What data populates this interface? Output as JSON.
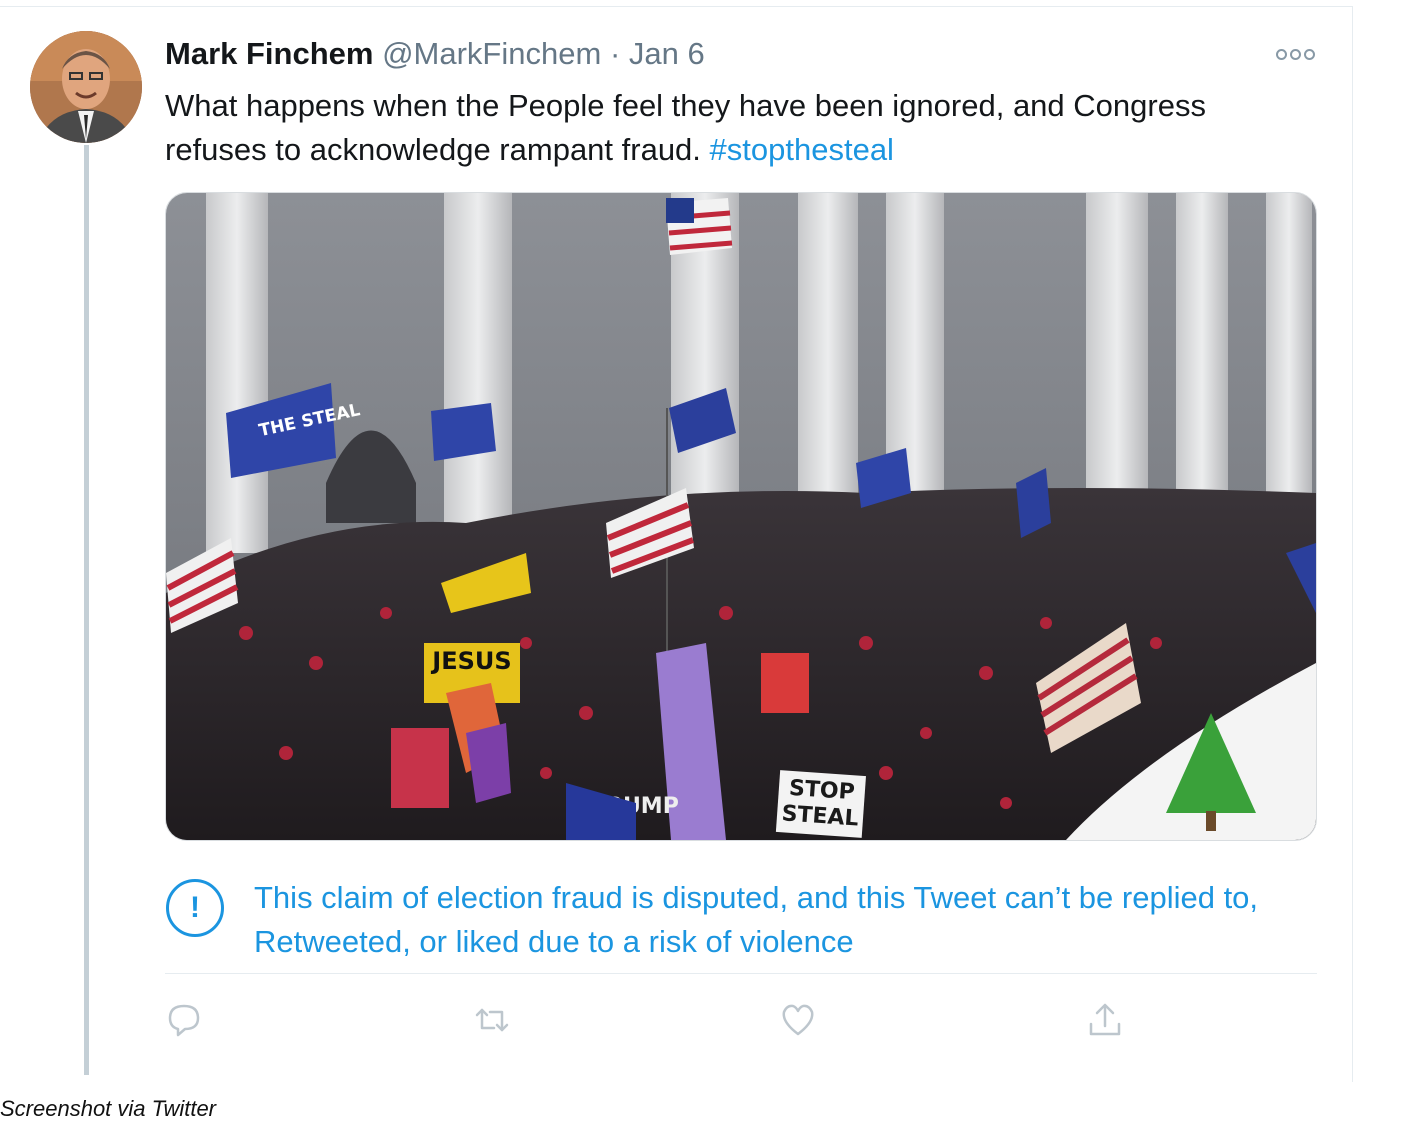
{
  "tweet": {
    "display_name": "Mark Finchem",
    "handle": "@MarkFinchem",
    "separator": "·",
    "date": "Jan 6",
    "text_main": "What happens when the People feel they have been ignored, and Congress refuses to acknowledge rampant fraud. ",
    "hashtag": "#stopthesteal",
    "notice_icon_glyph": "!",
    "notice": "This claim of election fraud is disputed, and this Tweet can’t be replied to, Retweeted, or liked due to a risk of violence",
    "photo_signs": {
      "left_flag": "THE STEAL",
      "jesus": "JESUS",
      "trump": "TRUMP",
      "stop": "STOP",
      "steal": "STEAL"
    }
  },
  "actions": [
    {
      "name": "reply-icon"
    },
    {
      "name": "retweet-icon"
    },
    {
      "name": "like-icon"
    },
    {
      "name": "share-icon"
    }
  ],
  "colors": {
    "link": "#1b95e0",
    "text": "#14171a",
    "muted": "#657786",
    "icon_gray": "#8899a6"
  },
  "caption": "Screenshot via Twitter"
}
